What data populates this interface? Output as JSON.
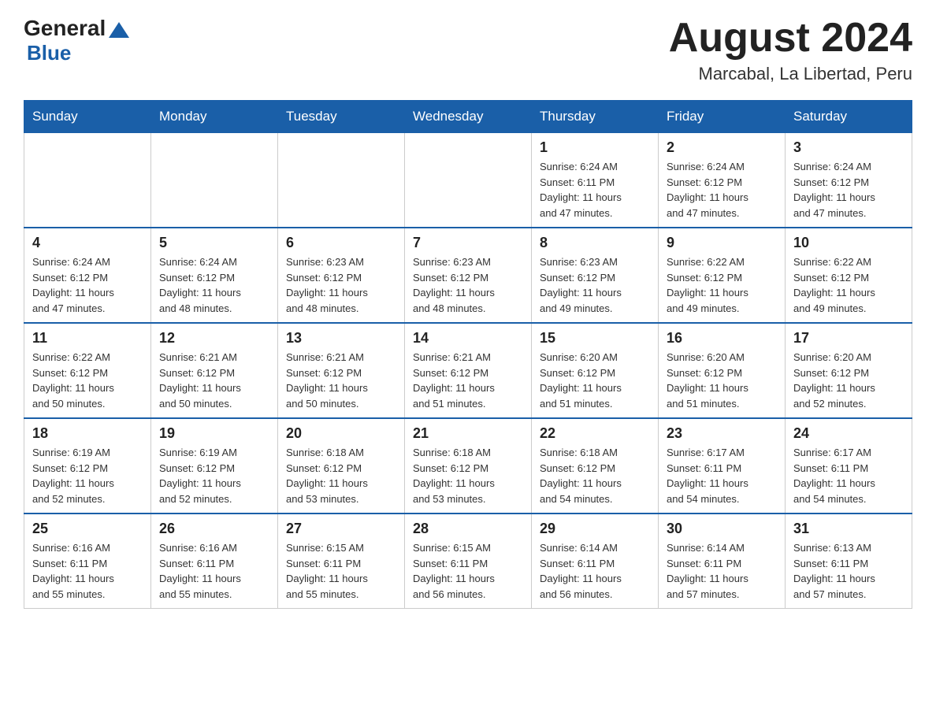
{
  "header": {
    "logo_general": "General",
    "logo_blue": "Blue",
    "title": "August 2024",
    "subtitle": "Marcabal, La Libertad, Peru"
  },
  "days_of_week": [
    "Sunday",
    "Monday",
    "Tuesday",
    "Wednesday",
    "Thursday",
    "Friday",
    "Saturday"
  ],
  "weeks": [
    [
      {
        "day": "",
        "info": ""
      },
      {
        "day": "",
        "info": ""
      },
      {
        "day": "",
        "info": ""
      },
      {
        "day": "",
        "info": ""
      },
      {
        "day": "1",
        "info": "Sunrise: 6:24 AM\nSunset: 6:11 PM\nDaylight: 11 hours\nand 47 minutes."
      },
      {
        "day": "2",
        "info": "Sunrise: 6:24 AM\nSunset: 6:12 PM\nDaylight: 11 hours\nand 47 minutes."
      },
      {
        "day": "3",
        "info": "Sunrise: 6:24 AM\nSunset: 6:12 PM\nDaylight: 11 hours\nand 47 minutes."
      }
    ],
    [
      {
        "day": "4",
        "info": "Sunrise: 6:24 AM\nSunset: 6:12 PM\nDaylight: 11 hours\nand 47 minutes."
      },
      {
        "day": "5",
        "info": "Sunrise: 6:24 AM\nSunset: 6:12 PM\nDaylight: 11 hours\nand 48 minutes."
      },
      {
        "day": "6",
        "info": "Sunrise: 6:23 AM\nSunset: 6:12 PM\nDaylight: 11 hours\nand 48 minutes."
      },
      {
        "day": "7",
        "info": "Sunrise: 6:23 AM\nSunset: 6:12 PM\nDaylight: 11 hours\nand 48 minutes."
      },
      {
        "day": "8",
        "info": "Sunrise: 6:23 AM\nSunset: 6:12 PM\nDaylight: 11 hours\nand 49 minutes."
      },
      {
        "day": "9",
        "info": "Sunrise: 6:22 AM\nSunset: 6:12 PM\nDaylight: 11 hours\nand 49 minutes."
      },
      {
        "day": "10",
        "info": "Sunrise: 6:22 AM\nSunset: 6:12 PM\nDaylight: 11 hours\nand 49 minutes."
      }
    ],
    [
      {
        "day": "11",
        "info": "Sunrise: 6:22 AM\nSunset: 6:12 PM\nDaylight: 11 hours\nand 50 minutes."
      },
      {
        "day": "12",
        "info": "Sunrise: 6:21 AM\nSunset: 6:12 PM\nDaylight: 11 hours\nand 50 minutes."
      },
      {
        "day": "13",
        "info": "Sunrise: 6:21 AM\nSunset: 6:12 PM\nDaylight: 11 hours\nand 50 minutes."
      },
      {
        "day": "14",
        "info": "Sunrise: 6:21 AM\nSunset: 6:12 PM\nDaylight: 11 hours\nand 51 minutes."
      },
      {
        "day": "15",
        "info": "Sunrise: 6:20 AM\nSunset: 6:12 PM\nDaylight: 11 hours\nand 51 minutes."
      },
      {
        "day": "16",
        "info": "Sunrise: 6:20 AM\nSunset: 6:12 PM\nDaylight: 11 hours\nand 51 minutes."
      },
      {
        "day": "17",
        "info": "Sunrise: 6:20 AM\nSunset: 6:12 PM\nDaylight: 11 hours\nand 52 minutes."
      }
    ],
    [
      {
        "day": "18",
        "info": "Sunrise: 6:19 AM\nSunset: 6:12 PM\nDaylight: 11 hours\nand 52 minutes."
      },
      {
        "day": "19",
        "info": "Sunrise: 6:19 AM\nSunset: 6:12 PM\nDaylight: 11 hours\nand 52 minutes."
      },
      {
        "day": "20",
        "info": "Sunrise: 6:18 AM\nSunset: 6:12 PM\nDaylight: 11 hours\nand 53 minutes."
      },
      {
        "day": "21",
        "info": "Sunrise: 6:18 AM\nSunset: 6:12 PM\nDaylight: 11 hours\nand 53 minutes."
      },
      {
        "day": "22",
        "info": "Sunrise: 6:18 AM\nSunset: 6:12 PM\nDaylight: 11 hours\nand 54 minutes."
      },
      {
        "day": "23",
        "info": "Sunrise: 6:17 AM\nSunset: 6:11 PM\nDaylight: 11 hours\nand 54 minutes."
      },
      {
        "day": "24",
        "info": "Sunrise: 6:17 AM\nSunset: 6:11 PM\nDaylight: 11 hours\nand 54 minutes."
      }
    ],
    [
      {
        "day": "25",
        "info": "Sunrise: 6:16 AM\nSunset: 6:11 PM\nDaylight: 11 hours\nand 55 minutes."
      },
      {
        "day": "26",
        "info": "Sunrise: 6:16 AM\nSunset: 6:11 PM\nDaylight: 11 hours\nand 55 minutes."
      },
      {
        "day": "27",
        "info": "Sunrise: 6:15 AM\nSunset: 6:11 PM\nDaylight: 11 hours\nand 55 minutes."
      },
      {
        "day": "28",
        "info": "Sunrise: 6:15 AM\nSunset: 6:11 PM\nDaylight: 11 hours\nand 56 minutes."
      },
      {
        "day": "29",
        "info": "Sunrise: 6:14 AM\nSunset: 6:11 PM\nDaylight: 11 hours\nand 56 minutes."
      },
      {
        "day": "30",
        "info": "Sunrise: 6:14 AM\nSunset: 6:11 PM\nDaylight: 11 hours\nand 57 minutes."
      },
      {
        "day": "31",
        "info": "Sunrise: 6:13 AM\nSunset: 6:11 PM\nDaylight: 11 hours\nand 57 minutes."
      }
    ]
  ]
}
